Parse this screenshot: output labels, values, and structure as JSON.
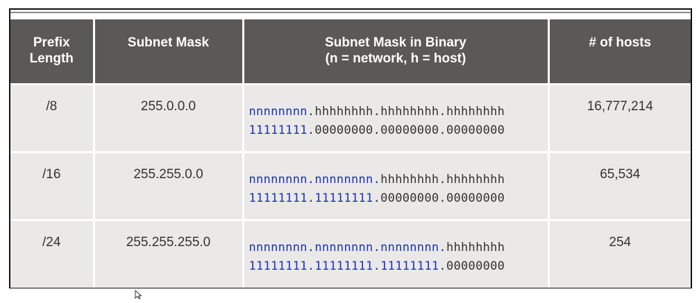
{
  "table": {
    "headers": [
      {
        "line1": "Prefix",
        "line2": "Length"
      },
      {
        "line1": "Subnet Mask",
        "line2": ""
      },
      {
        "line1": "Subnet Mask in Binary",
        "line2": "(n = network, h = host)"
      },
      {
        "line1": "# of hosts",
        "line2": ""
      }
    ],
    "rows": [
      {
        "prefix": "/8",
        "mask": "255.0.0.0",
        "pattern_net": "nnnnnnnn",
        "pattern_host": ".hhhhhhhh.hhhhhhhh.hhhhhhhh",
        "binary_net": "11111111",
        "binary_host": ".00000000.00000000.00000000",
        "hosts": "16,777,214"
      },
      {
        "prefix": "/16",
        "mask": "255.255.0.0",
        "pattern_net": "nnnnnnnn.nnnnnnnn.",
        "pattern_host": "hhhhhhhh.hhhhhhhh",
        "binary_net": "11111111.11111111",
        "binary_host": ".00000000.00000000",
        "hosts": "65,534"
      },
      {
        "prefix": "/24",
        "mask": "255.255.255.0",
        "pattern_net": "nnnnnnnn.nnnnnnnn.nnnnnnnn.",
        "pattern_host": "hhhhhhhh",
        "binary_net": "11111111.11111111.11111111",
        "binary_host": ".00000000",
        "hosts": "254"
      }
    ]
  },
  "colors": {
    "header_bg": "#5b5957",
    "row_bg": "#ebe9e7",
    "network_bits": "#1a31b8"
  },
  "icons": {
    "cursor": "mouse-pointer-icon"
  }
}
